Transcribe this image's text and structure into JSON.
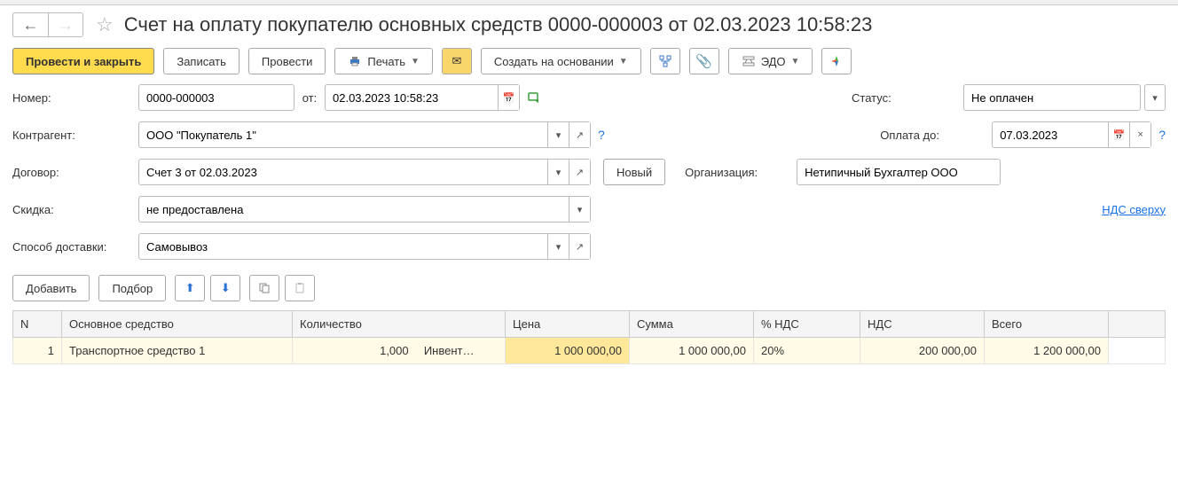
{
  "header": {
    "title": "Счет на оплату покупателю основных средств 0000-000003 от 02.03.2023 10:58:23"
  },
  "toolbar": {
    "post_close": "Провести и закрыть",
    "save": "Записать",
    "post": "Провести",
    "print": "Печать",
    "create_based": "Создать на основании",
    "edo": "ЭДО"
  },
  "form": {
    "number_label": "Номер:",
    "number_value": "0000-000003",
    "from_label": "от:",
    "date_value": "02.03.2023 10:58:23",
    "status_label": "Статус:",
    "status_value": "Не оплачен",
    "counterparty_label": "Контрагент:",
    "counterparty_value": "ООО \"Покупатель 1\"",
    "pay_until_label": "Оплата до:",
    "pay_until_value": "07.03.2023",
    "contract_label": "Договор:",
    "contract_value": "Счет 3 от 02.03.2023",
    "new_btn": "Новый",
    "org_label": "Организация:",
    "org_value": "Нетипичный Бухгалтер ООО",
    "discount_label": "Скидка:",
    "discount_value": "не предоставлена",
    "vat_link": "НДС сверху",
    "delivery_label": "Способ доставки:",
    "delivery_value": "Самовывоз"
  },
  "table_toolbar": {
    "add": "Добавить",
    "select": "Подбор"
  },
  "table": {
    "columns": {
      "n": "N",
      "asset": "Основное средство",
      "qty": "Количество",
      "price": "Цена",
      "sum": "Сумма",
      "vat_rate": "% НДС",
      "vat": "НДС",
      "total": "Всего"
    },
    "rows": [
      {
        "n": "1",
        "asset": "Транспортное средство 1",
        "qty": "1,000",
        "qty_unit": "Инвент…",
        "price": "1 000 000,00",
        "sum": "1 000 000,00",
        "vat_rate": "20%",
        "vat": "200 000,00",
        "total": "1 200 000,00"
      }
    ]
  }
}
